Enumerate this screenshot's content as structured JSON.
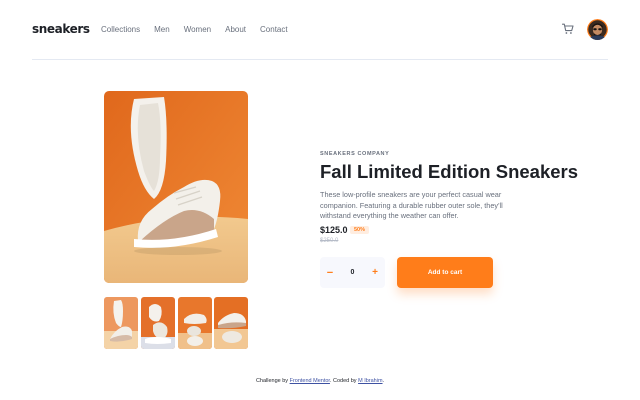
{
  "header": {
    "logo": "sneakers",
    "nav": [
      {
        "label": "Collections"
      },
      {
        "label": "Men"
      },
      {
        "label": "Women"
      },
      {
        "label": "About"
      },
      {
        "label": "Contact"
      }
    ],
    "cart_icon": "cart-icon",
    "avatar_icon": "user-avatar"
  },
  "product": {
    "company": "SNEAKERS COMPANY",
    "title": "Fall Limited Edition Sneakers",
    "description": "These low-profile sneakers are your perfect casual wear companion. Featuring a durable rubber outer sole, they'll withstand everything the weather can offer.",
    "price": "$125.0",
    "discount": "50%",
    "old_price": "$250.0",
    "quantity": {
      "minus": "−",
      "value": "0",
      "plus": "+"
    },
    "add_to_cart": "Add to cart"
  },
  "gallery": {
    "thumbnails_count_visible": 4,
    "selected_thumbnail": 1
  },
  "attribution": {
    "prefix": "Challenge by",
    "challenge_link": "Frontend Mentor",
    "middle": ". Coded by",
    "author_link": "M Ibrahim",
    "suffix": "."
  },
  "colors": {
    "accent": "#ff7d1a",
    "accent_pale": "#ffede0",
    "dark": "#1d2026",
    "muted": "#69707d",
    "light_muted": "#b6bcc8",
    "qty_bg": "#f7f8fd"
  }
}
